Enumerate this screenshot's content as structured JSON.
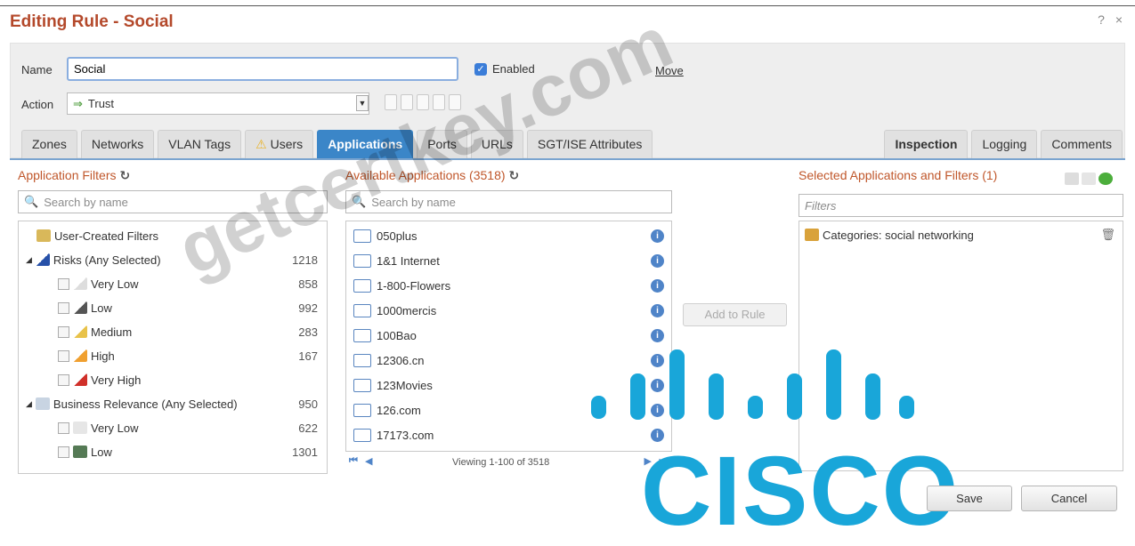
{
  "dialog": {
    "title": "Editing Rule - Social",
    "controls": "? ×"
  },
  "rule": {
    "name_label": "Name",
    "name_value": "Social",
    "enabled_label": "Enabled",
    "enabled_checked": true,
    "move_label": "Move",
    "action_label": "Action",
    "action_value": "Trust"
  },
  "tabs": [
    "Zones",
    "Networks",
    "VLAN Tags",
    "Users",
    "Applications",
    "Ports",
    "URLs",
    "SGT/ISE Attributes"
  ],
  "active_tab": "Applications",
  "right_tabs": [
    "Inspection",
    "Logging",
    "Comments"
  ],
  "app_filters": {
    "title": "Application Filters",
    "search_placeholder": "Search by name",
    "items": [
      {
        "label": "User-Created Filters",
        "count": ""
      },
      {
        "label": "Risks (Any Selected)",
        "count": "1218"
      },
      {
        "label": "Very Low",
        "count": "858"
      },
      {
        "label": "Low",
        "count": "992"
      },
      {
        "label": "Medium",
        "count": "283"
      },
      {
        "label": "High",
        "count": "167"
      },
      {
        "label": "Very High",
        "count": ""
      },
      {
        "label": "Business Relevance (Any Selected)",
        "count": "950"
      },
      {
        "label": "Very Low",
        "count": "622"
      },
      {
        "label": "Low",
        "count": "1301"
      }
    ]
  },
  "available": {
    "title": "Available Applications (3518)",
    "search_placeholder": "Search by name",
    "apps": [
      "050plus",
      "1&1 Internet",
      "1-800-Flowers",
      "1000mercis",
      "100Bao",
      "12306.cn",
      "123Movies",
      "126.com",
      "17173.com"
    ],
    "pager_text": "Viewing 1-100 of 3518"
  },
  "add_button": "Add to Rule",
  "selected": {
    "title": "Selected Applications and Filters (1)",
    "filter_placeholder": "Filters",
    "items": [
      "Categories: social networking"
    ]
  },
  "footer": {
    "save": "Save",
    "cancel": "Cancel"
  },
  "watermark": "getcertkey.com",
  "logo_text": "CISCO"
}
